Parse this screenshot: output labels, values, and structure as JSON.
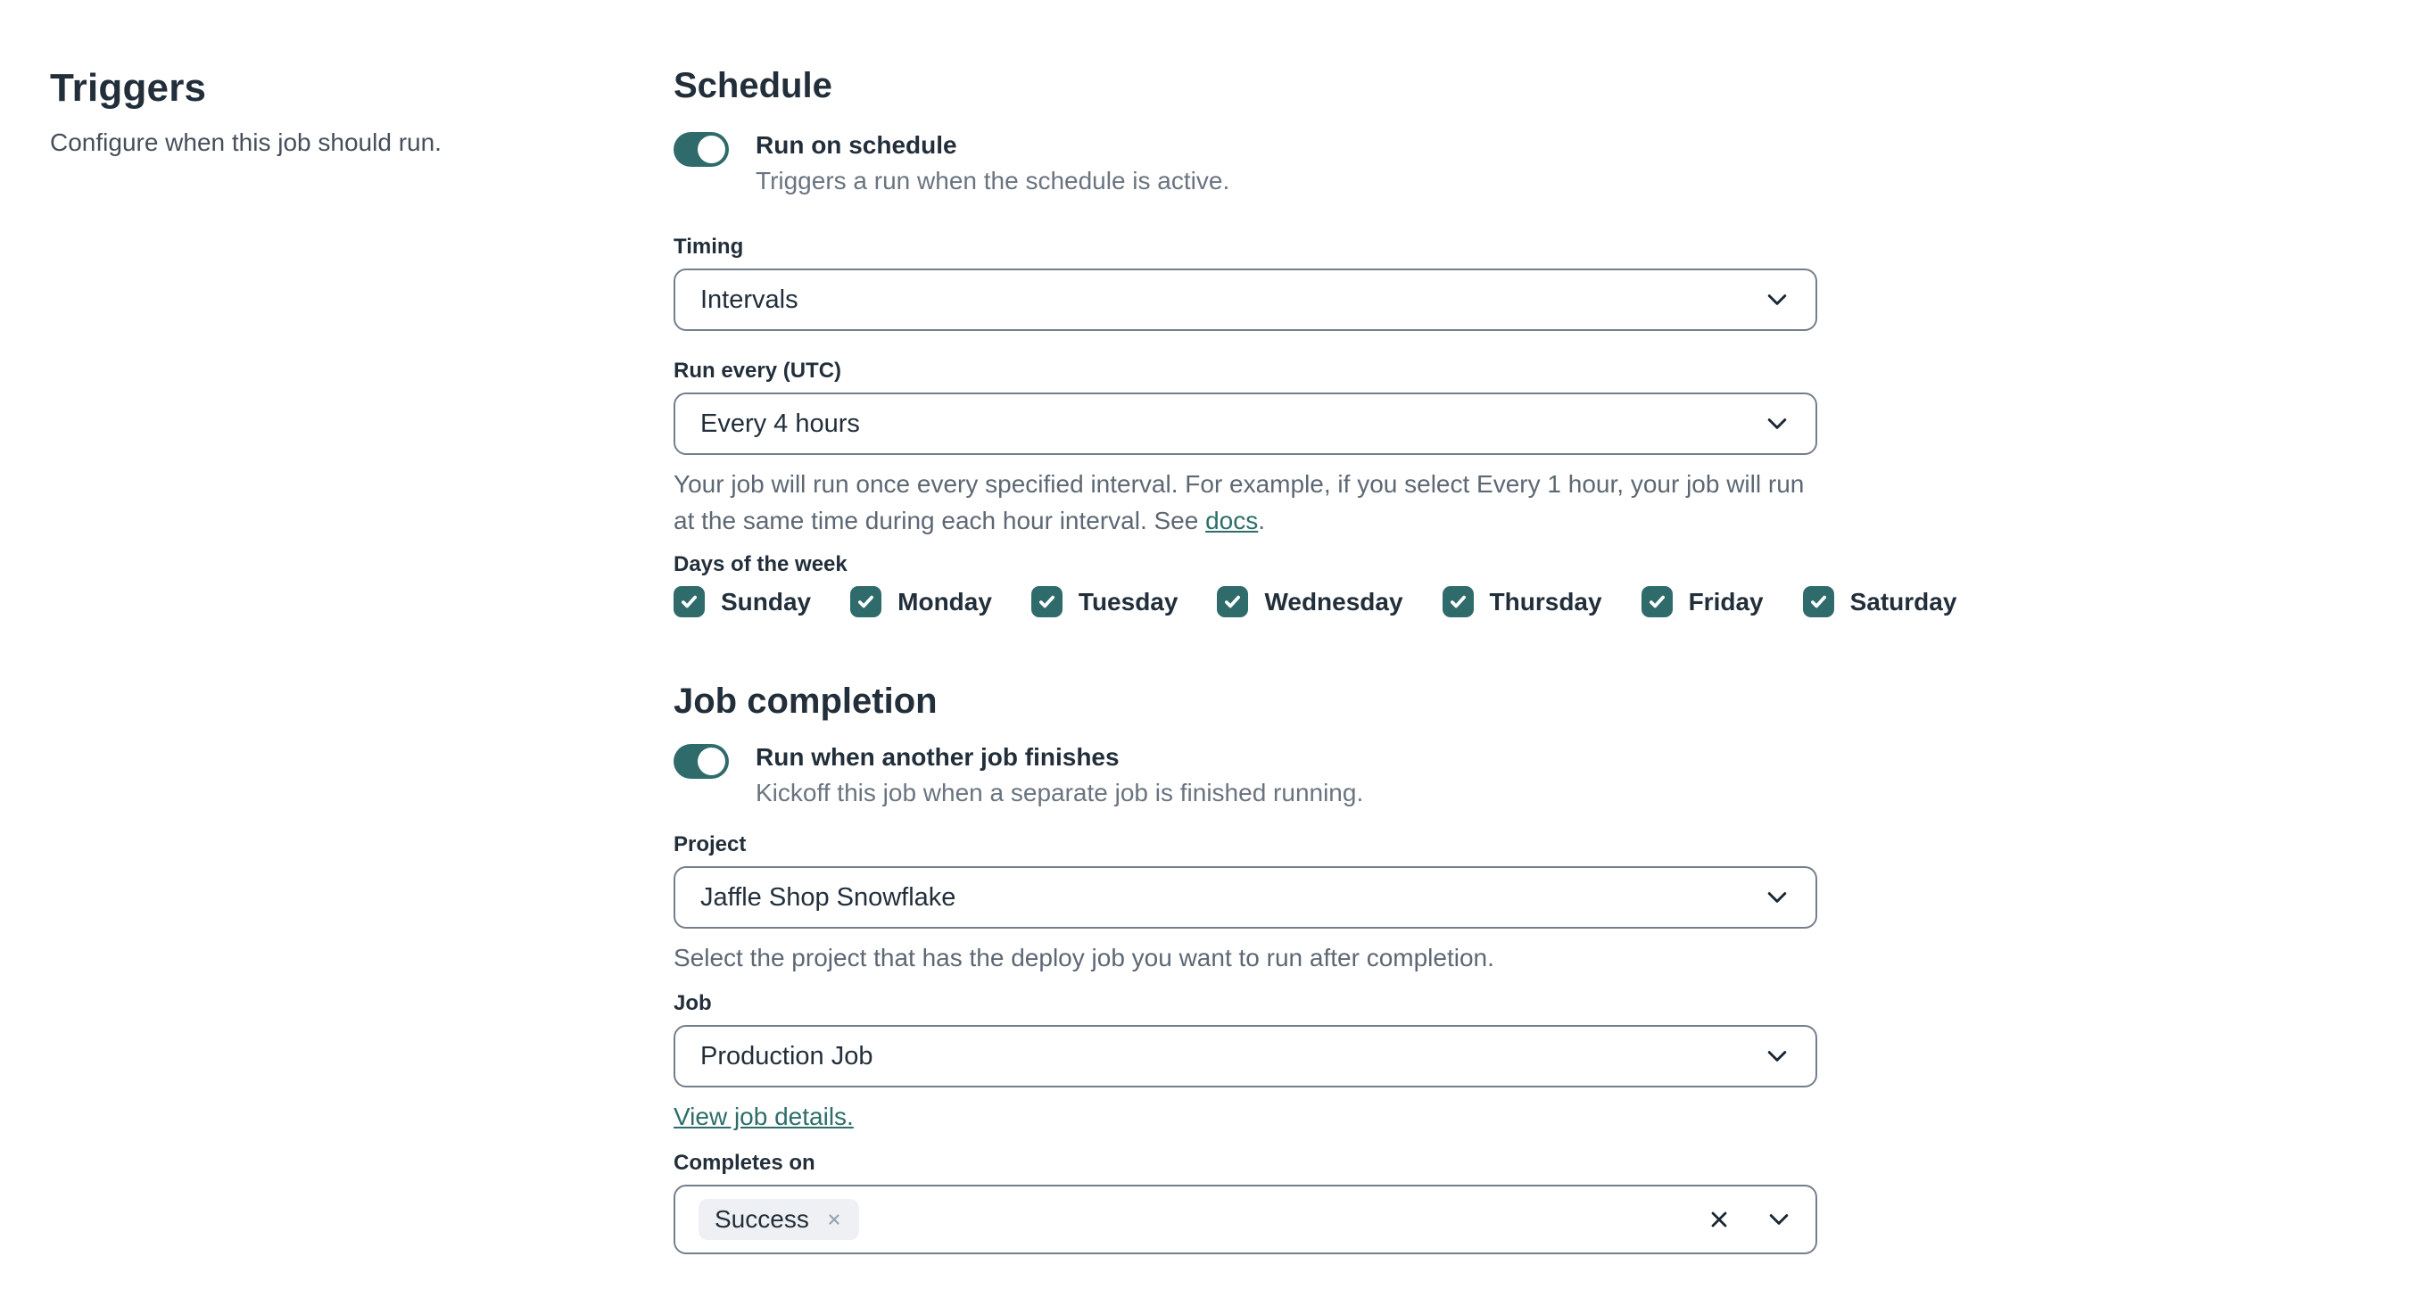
{
  "sidebar": {
    "title": "Triggers",
    "subtitle": "Configure when this job should run."
  },
  "schedule": {
    "heading": "Schedule",
    "toggle": {
      "label": "Run on schedule",
      "description": "Triggers a run when the schedule is active.",
      "state": "on"
    },
    "timing": {
      "label": "Timing",
      "value": "Intervals"
    },
    "run_every": {
      "label": "Run every (UTC)",
      "value": "Every 4 hours",
      "help_prefix": "Your job will run once every specified interval. For example, if you select Every 1 hour, your job will run at the same time during each hour interval. See ",
      "help_link": "docs",
      "help_suffix": "."
    },
    "days": {
      "label": "Days of the week",
      "items": [
        {
          "label": "Sunday",
          "checked": true
        },
        {
          "label": "Monday",
          "checked": true
        },
        {
          "label": "Tuesday",
          "checked": true
        },
        {
          "label": "Wednesday",
          "checked": true
        },
        {
          "label": "Thursday",
          "checked": true
        },
        {
          "label": "Friday",
          "checked": true
        },
        {
          "label": "Saturday",
          "checked": true
        }
      ]
    }
  },
  "job_completion": {
    "heading": "Job completion",
    "toggle": {
      "label": "Run when another job finishes",
      "description": "Kickoff this job when a separate job is finished running.",
      "state": "on"
    },
    "project": {
      "label": "Project",
      "value": "Jaffle Shop Snowflake",
      "help": "Select the project that has the deploy job you want to run after completion."
    },
    "job": {
      "label": "Job",
      "value": "Production Job",
      "link": "View job details."
    },
    "completes_on": {
      "label": "Completes on",
      "chips": [
        {
          "label": "Success"
        }
      ]
    }
  },
  "colors": {
    "accent_teal": "#2f6b6a",
    "link_teal": "#2d6e6a",
    "border_gray": "#747f8b",
    "chip_bg": "#eef0f3",
    "text_dark": "#222f3b",
    "text_gray": "#6a7480"
  }
}
